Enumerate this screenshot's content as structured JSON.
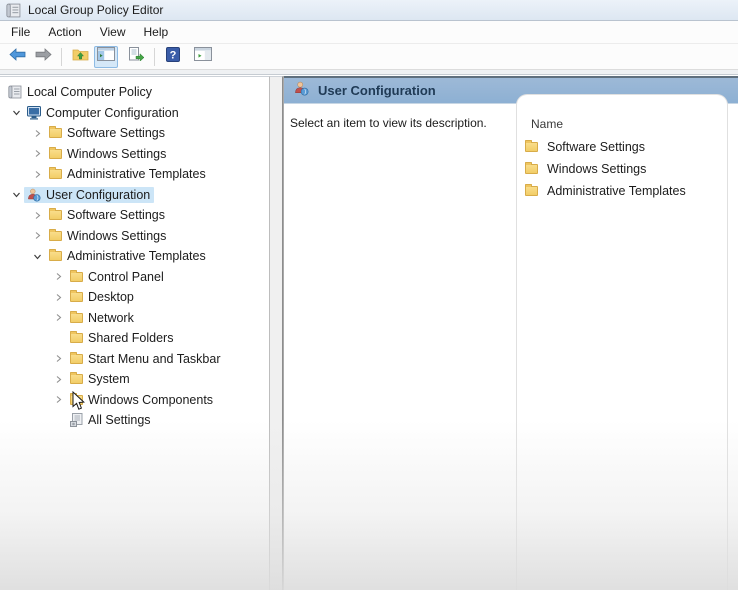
{
  "window": {
    "title": "Local Group Policy Editor"
  },
  "menu": {
    "items": [
      "File",
      "Action",
      "View",
      "Help"
    ]
  },
  "toolbar": {
    "buttons": [
      {
        "name": "back",
        "icon": "arrow-left-icon",
        "enabled": true
      },
      {
        "name": "forward",
        "icon": "arrow-right-icon",
        "enabled": false
      },
      {
        "name": "up-one-level",
        "icon": "folder-up-icon"
      },
      {
        "name": "show-console-tree",
        "icon": "console-tree-icon",
        "active": true
      },
      {
        "name": "export-list",
        "icon": "export-list-icon"
      },
      {
        "name": "help",
        "icon": "help-icon"
      },
      {
        "name": "show-action-pane",
        "icon": "action-pane-icon"
      }
    ]
  },
  "tree": {
    "items": [
      {
        "label": "Local Computer Policy",
        "level": 0,
        "icon": "gpo",
        "chevron": "none",
        "selected": false
      },
      {
        "label": "Computer Configuration",
        "level": 1,
        "icon": "computer",
        "chevron": "expanded",
        "selected": false
      },
      {
        "label": "Software Settings",
        "level": 2,
        "icon": "folder",
        "chevron": "collapsed",
        "selected": false
      },
      {
        "label": "Windows Settings",
        "level": 2,
        "icon": "folder",
        "chevron": "collapsed",
        "selected": false
      },
      {
        "label": "Administrative Templates",
        "level": 2,
        "icon": "folder",
        "chevron": "collapsed",
        "selected": false
      },
      {
        "label": "User Configuration",
        "level": 1,
        "icon": "user",
        "chevron": "expanded",
        "selected": true
      },
      {
        "label": "Software Settings",
        "level": 2,
        "icon": "folder",
        "chevron": "collapsed",
        "selected": false
      },
      {
        "label": "Windows Settings",
        "level": 2,
        "icon": "folder",
        "chevron": "collapsed",
        "selected": false
      },
      {
        "label": "Administrative Templates",
        "level": 2,
        "icon": "folder",
        "chevron": "expanded",
        "selected": false
      },
      {
        "label": "Control Panel",
        "level": 3,
        "icon": "folder",
        "chevron": "collapsed",
        "selected": false
      },
      {
        "label": "Desktop",
        "level": 3,
        "icon": "folder",
        "chevron": "collapsed",
        "selected": false
      },
      {
        "label": "Network",
        "level": 3,
        "icon": "folder",
        "chevron": "collapsed",
        "selected": false
      },
      {
        "label": "Shared Folders",
        "level": 3,
        "icon": "folder",
        "chevron": "none",
        "selected": false
      },
      {
        "label": "Start Menu and Taskbar",
        "level": 3,
        "icon": "folder",
        "chevron": "collapsed",
        "selected": false
      },
      {
        "label": "System",
        "level": 3,
        "icon": "folder",
        "chevron": "collapsed",
        "selected": false
      },
      {
        "label": "Windows Components",
        "level": 3,
        "icon": "folder",
        "chevron": "collapsed",
        "selected": false
      },
      {
        "label": "All Settings",
        "level": 3,
        "icon": "all-settings",
        "chevron": "none",
        "selected": false
      }
    ]
  },
  "right_pane": {
    "header": {
      "title": "User Configuration",
      "icon": "user-icon"
    },
    "description": "Select an item to view its description.",
    "list": {
      "column_header": "Name",
      "items": [
        {
          "label": "Software Settings",
          "icon": "folder"
        },
        {
          "label": "Windows Settings",
          "icon": "folder"
        },
        {
          "label": "Administrative Templates",
          "icon": "folder"
        }
      ]
    }
  },
  "accents": {
    "selection_highlight": "#cce5f7",
    "header_gradient_top": "#9db9d7",
    "header_gradient_bottom": "#8db0d3",
    "folder_color": "#f2cd67",
    "titlebar_bg": "#e3ecf6"
  }
}
